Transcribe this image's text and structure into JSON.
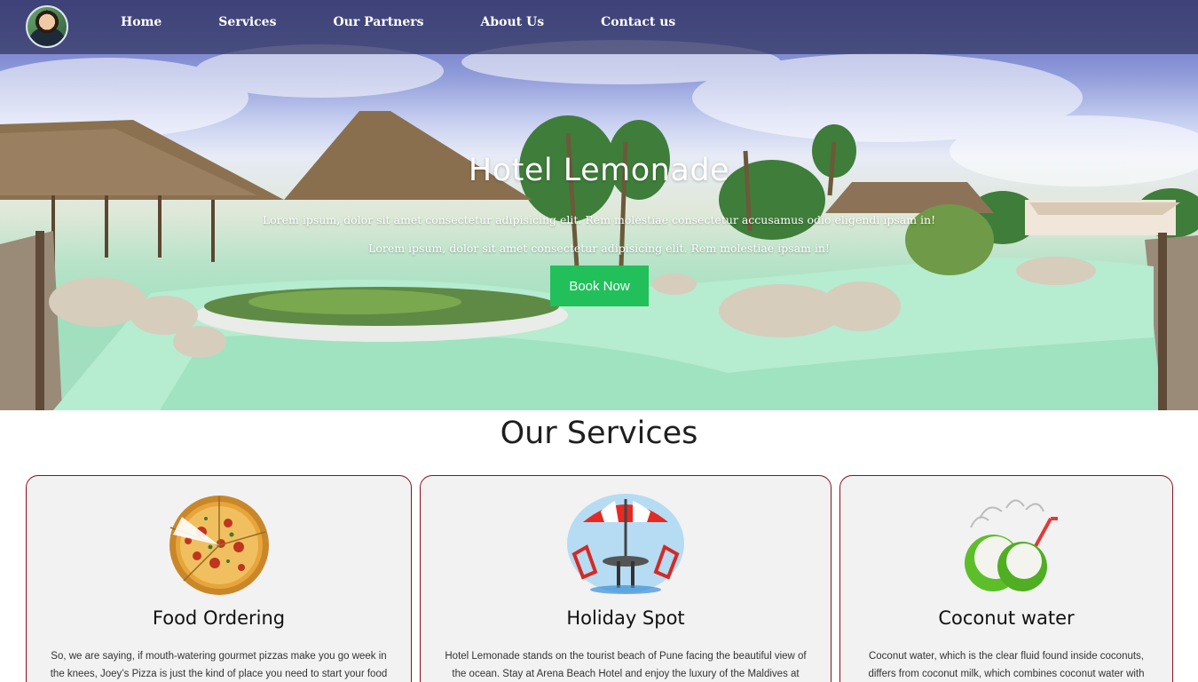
{
  "nav": {
    "avatar_alt": "profile avatar",
    "links": [
      {
        "label": "Home"
      },
      {
        "label": "Services"
      },
      {
        "label": "Our Partners"
      },
      {
        "label": "About Us"
      },
      {
        "label": "Contact us"
      }
    ]
  },
  "hero": {
    "title": "Hotel Lemonade",
    "line1": "Lorem ipsum, dolor sit amet consectetur adipisicing elit. Rem molestiae consectetur accusamus odio eligendi ipsam in!",
    "line2": "Lorem ipsum, dolor sit amet consectetur adipisicing elit. Rem molestiae ipsam in!",
    "button_label": "Book Now",
    "button_color": "#21c05b"
  },
  "services": {
    "title": "Our Services",
    "cards": [
      {
        "icon": "pizza-icon",
        "title": "Food Ordering",
        "text": "So, we are saying, if mouth-watering gourmet pizzas make you go week in the knees, Joey’s Pizza is just the kind of place you need to start your food"
      },
      {
        "icon": "beach-umbrella-icon",
        "title": "Holiday Spot",
        "text": "Hotel Lemonade stands on the tourist beach of Pune facing the beautiful view of the ocean. Stay at Arena Beach Hotel and enjoy the luxury of the Maldives at"
      },
      {
        "icon": "coconut-icon",
        "title": "Coconut water",
        "text": "Coconut water, which is the clear fluid found inside coconuts, differs from coconut milk, which combines coconut water with"
      }
    ]
  },
  "colors": {
    "nav_bg": "#32345f",
    "card_border": "#8a1020",
    "card_bg": "#f2f2f2"
  }
}
